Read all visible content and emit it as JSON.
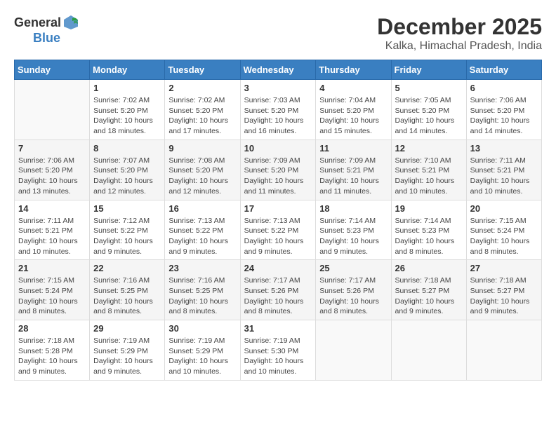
{
  "logo": {
    "general": "General",
    "blue": "Blue"
  },
  "title": {
    "month": "December 2025",
    "location": "Kalka, Himachal Pradesh, India"
  },
  "headers": [
    "Sunday",
    "Monday",
    "Tuesday",
    "Wednesday",
    "Thursday",
    "Friday",
    "Saturday"
  ],
  "weeks": [
    [
      {
        "day": "",
        "info": ""
      },
      {
        "day": "1",
        "info": "Sunrise: 7:02 AM\nSunset: 5:20 PM\nDaylight: 10 hours\nand 18 minutes."
      },
      {
        "day": "2",
        "info": "Sunrise: 7:02 AM\nSunset: 5:20 PM\nDaylight: 10 hours\nand 17 minutes."
      },
      {
        "day": "3",
        "info": "Sunrise: 7:03 AM\nSunset: 5:20 PM\nDaylight: 10 hours\nand 16 minutes."
      },
      {
        "day": "4",
        "info": "Sunrise: 7:04 AM\nSunset: 5:20 PM\nDaylight: 10 hours\nand 15 minutes."
      },
      {
        "day": "5",
        "info": "Sunrise: 7:05 AM\nSunset: 5:20 PM\nDaylight: 10 hours\nand 14 minutes."
      },
      {
        "day": "6",
        "info": "Sunrise: 7:06 AM\nSunset: 5:20 PM\nDaylight: 10 hours\nand 14 minutes."
      }
    ],
    [
      {
        "day": "7",
        "info": "Sunrise: 7:06 AM\nSunset: 5:20 PM\nDaylight: 10 hours\nand 13 minutes."
      },
      {
        "day": "8",
        "info": "Sunrise: 7:07 AM\nSunset: 5:20 PM\nDaylight: 10 hours\nand 12 minutes."
      },
      {
        "day": "9",
        "info": "Sunrise: 7:08 AM\nSunset: 5:20 PM\nDaylight: 10 hours\nand 12 minutes."
      },
      {
        "day": "10",
        "info": "Sunrise: 7:09 AM\nSunset: 5:20 PM\nDaylight: 10 hours\nand 11 minutes."
      },
      {
        "day": "11",
        "info": "Sunrise: 7:09 AM\nSunset: 5:21 PM\nDaylight: 10 hours\nand 11 minutes."
      },
      {
        "day": "12",
        "info": "Sunrise: 7:10 AM\nSunset: 5:21 PM\nDaylight: 10 hours\nand 10 minutes."
      },
      {
        "day": "13",
        "info": "Sunrise: 7:11 AM\nSunset: 5:21 PM\nDaylight: 10 hours\nand 10 minutes."
      }
    ],
    [
      {
        "day": "14",
        "info": "Sunrise: 7:11 AM\nSunset: 5:21 PM\nDaylight: 10 hours\nand 10 minutes."
      },
      {
        "day": "15",
        "info": "Sunrise: 7:12 AM\nSunset: 5:22 PM\nDaylight: 10 hours\nand 9 minutes."
      },
      {
        "day": "16",
        "info": "Sunrise: 7:13 AM\nSunset: 5:22 PM\nDaylight: 10 hours\nand 9 minutes."
      },
      {
        "day": "17",
        "info": "Sunrise: 7:13 AM\nSunset: 5:22 PM\nDaylight: 10 hours\nand 9 minutes."
      },
      {
        "day": "18",
        "info": "Sunrise: 7:14 AM\nSunset: 5:23 PM\nDaylight: 10 hours\nand 9 minutes."
      },
      {
        "day": "19",
        "info": "Sunrise: 7:14 AM\nSunset: 5:23 PM\nDaylight: 10 hours\nand 8 minutes."
      },
      {
        "day": "20",
        "info": "Sunrise: 7:15 AM\nSunset: 5:24 PM\nDaylight: 10 hours\nand 8 minutes."
      }
    ],
    [
      {
        "day": "21",
        "info": "Sunrise: 7:15 AM\nSunset: 5:24 PM\nDaylight: 10 hours\nand 8 minutes."
      },
      {
        "day": "22",
        "info": "Sunrise: 7:16 AM\nSunset: 5:25 PM\nDaylight: 10 hours\nand 8 minutes."
      },
      {
        "day": "23",
        "info": "Sunrise: 7:16 AM\nSunset: 5:25 PM\nDaylight: 10 hours\nand 8 minutes."
      },
      {
        "day": "24",
        "info": "Sunrise: 7:17 AM\nSunset: 5:26 PM\nDaylight: 10 hours\nand 8 minutes."
      },
      {
        "day": "25",
        "info": "Sunrise: 7:17 AM\nSunset: 5:26 PM\nDaylight: 10 hours\nand 8 minutes."
      },
      {
        "day": "26",
        "info": "Sunrise: 7:18 AM\nSunset: 5:27 PM\nDaylight: 10 hours\nand 9 minutes."
      },
      {
        "day": "27",
        "info": "Sunrise: 7:18 AM\nSunset: 5:27 PM\nDaylight: 10 hours\nand 9 minutes."
      }
    ],
    [
      {
        "day": "28",
        "info": "Sunrise: 7:18 AM\nSunset: 5:28 PM\nDaylight: 10 hours\nand 9 minutes."
      },
      {
        "day": "29",
        "info": "Sunrise: 7:19 AM\nSunset: 5:29 PM\nDaylight: 10 hours\nand 9 minutes."
      },
      {
        "day": "30",
        "info": "Sunrise: 7:19 AM\nSunset: 5:29 PM\nDaylight: 10 hours\nand 10 minutes."
      },
      {
        "day": "31",
        "info": "Sunrise: 7:19 AM\nSunset: 5:30 PM\nDaylight: 10 hours\nand 10 minutes."
      },
      {
        "day": "",
        "info": ""
      },
      {
        "day": "",
        "info": ""
      },
      {
        "day": "",
        "info": ""
      }
    ]
  ]
}
